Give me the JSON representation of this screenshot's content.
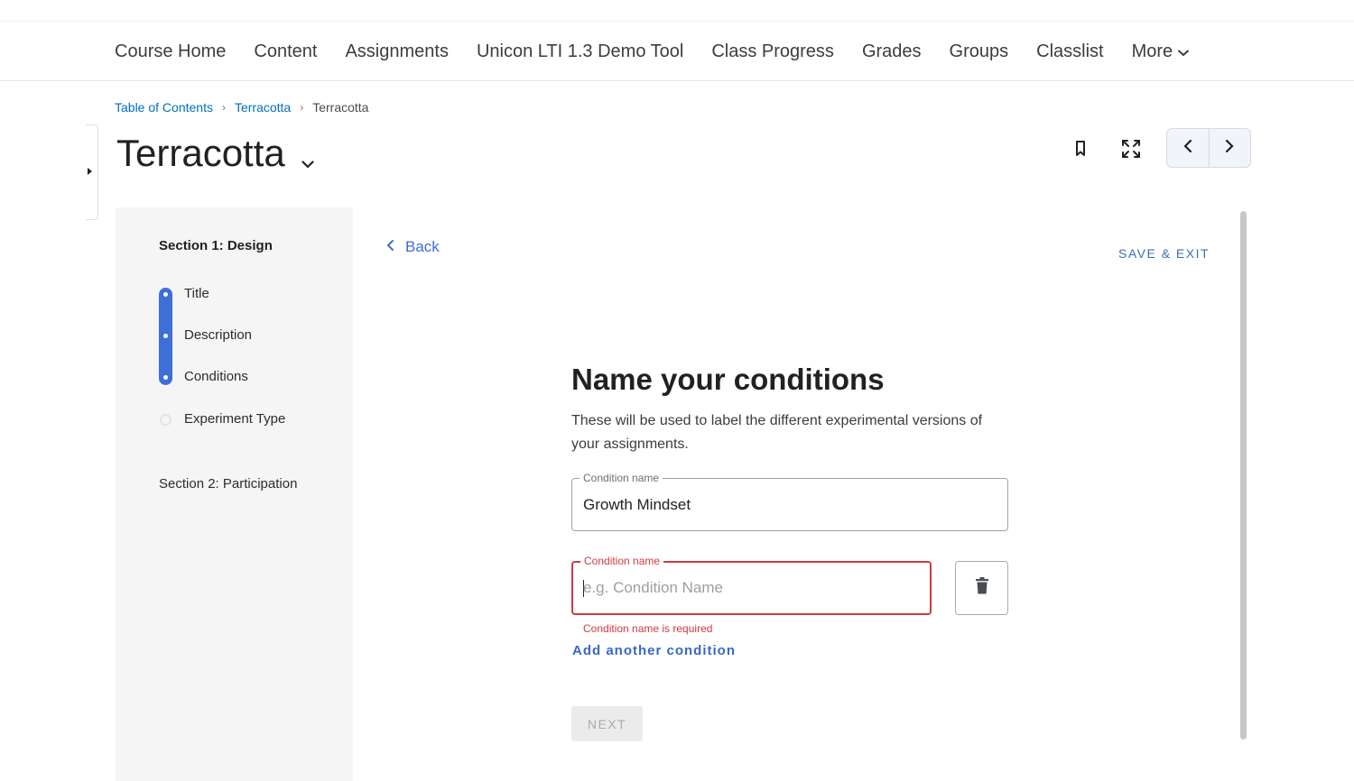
{
  "nav": {
    "items": [
      "Course Home",
      "Content",
      "Assignments",
      "Unicon LTI 1.3 Demo Tool",
      "Class Progress",
      "Grades",
      "Groups",
      "Classlist"
    ],
    "more_label": "More"
  },
  "breadcrumb": {
    "items": [
      "Table of Contents",
      "Terracotta"
    ],
    "current": "Terracotta"
  },
  "page": {
    "title": "Terracotta"
  },
  "sidebar": {
    "section1_title": "Section 1: Design",
    "steps": [
      "Title",
      "Description",
      "Conditions",
      "Experiment Type"
    ],
    "completed_steps": 3,
    "section2_title": "Section 2: Participation"
  },
  "tool": {
    "back_label": "Back",
    "save_exit_label": "SAVE & EXIT",
    "form_title": "Name your conditions",
    "form_description": "These will be used to label the different experimental versions of your assignments.",
    "conditions": [
      {
        "legend": "Condition name",
        "value": "Growth Mindset"
      },
      {
        "legend": "Condition name",
        "value": "",
        "placeholder": "e.g. Condition Name",
        "error": "Condition name is required"
      }
    ],
    "add_condition_label": "Add another condition",
    "next_label": "NEXT"
  },
  "colors": {
    "accent_blue": "#3e6fd8",
    "link_blue": "#006fbf",
    "error_red": "#d13942"
  },
  "icons": [
    "chevron-down-icon",
    "bookmark-icon",
    "fullscreen-icon",
    "chevron-left-icon",
    "chevron-right-icon",
    "trash-icon",
    "caret-right-icon"
  ]
}
